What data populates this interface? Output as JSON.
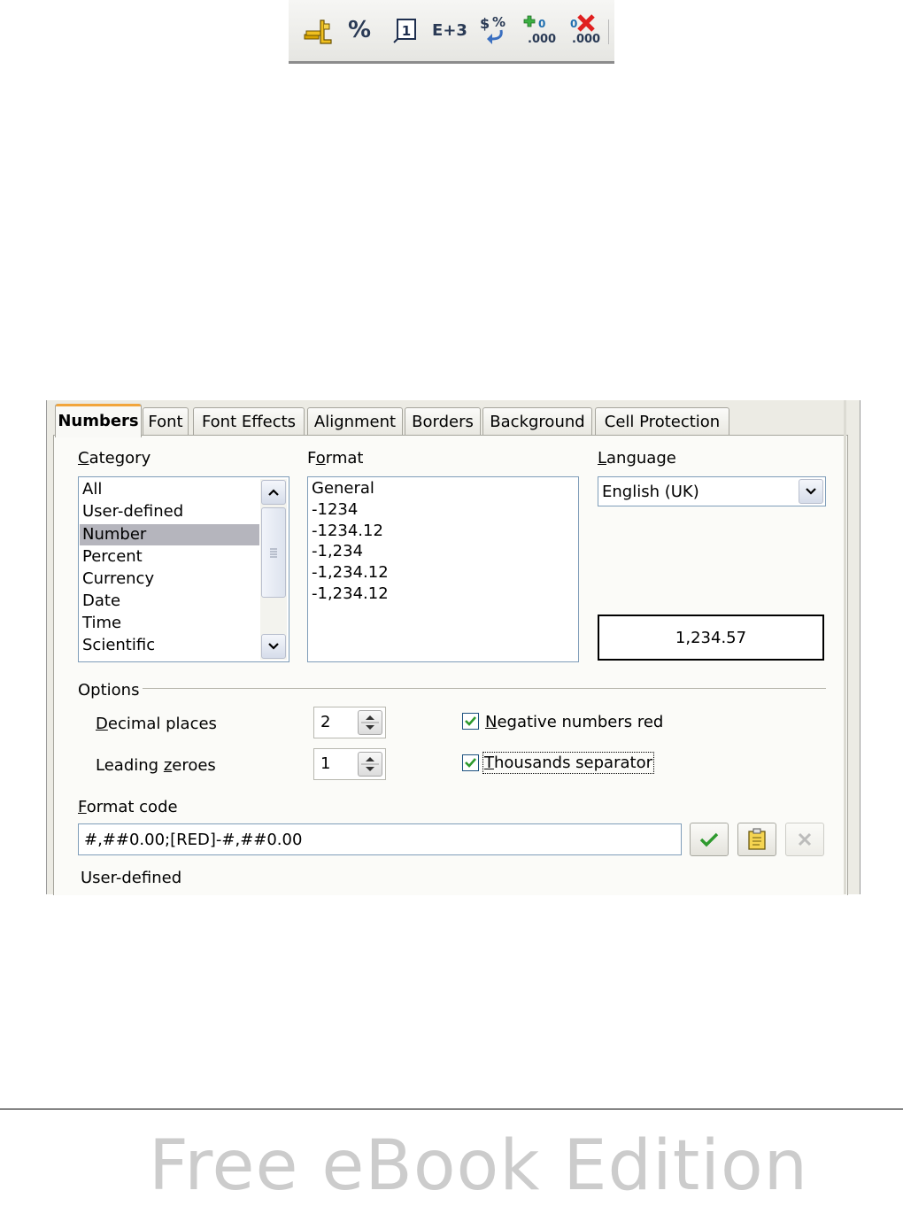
{
  "toolbar": {
    "buttons": [
      {
        "icon": "currency-format-icon"
      },
      {
        "icon": "percent-format-icon",
        "glyph": "%"
      },
      {
        "icon": "date-format-icon",
        "glyph": "1"
      },
      {
        "icon": "scientific-format-icon",
        "glyph": "E+3"
      },
      {
        "icon": "standard-format-icon",
        "glyph": "$%"
      },
      {
        "icon": "add-decimal-place-icon",
        "glyph": ".000"
      },
      {
        "icon": "delete-decimal-place-icon",
        "glyph": ".000"
      }
    ]
  },
  "dialog": {
    "tabs": [
      {
        "label": "Numbers",
        "active": true
      },
      {
        "label": "Font"
      },
      {
        "label": "Font Effects"
      },
      {
        "label": "Alignment"
      },
      {
        "label": "Borders"
      },
      {
        "label": "Background"
      },
      {
        "label": "Cell Protection"
      }
    ],
    "category": {
      "label": "Category",
      "items": [
        "All",
        "User-defined",
        "Number",
        "Percent",
        "Currency",
        "Date",
        "Time",
        "Scientific"
      ],
      "selected": "Number"
    },
    "format": {
      "label": "Format",
      "items": [
        "General",
        "-1234",
        "-1234.12",
        "-1,234",
        "-1,234.12",
        "-1,234.12"
      ]
    },
    "language": {
      "label": "Language",
      "value": "English (UK)"
    },
    "preview": "1,234.57",
    "options": {
      "label": "Options",
      "decimal_places": {
        "label": "Decimal places",
        "value": "2"
      },
      "leading_zeroes": {
        "label": "Leading zeroes",
        "value": "1"
      },
      "negative_red": {
        "label": "Negative numbers red",
        "checked": true
      },
      "thousands_separator": {
        "label": "Thousands separator",
        "checked": true
      }
    },
    "format_code": {
      "label": "Format code",
      "value": "#,##0.00;[RED]-#,##0.00",
      "description": "User-defined"
    },
    "colors": {
      "accent_tab": "#f2a53b",
      "check_green": "#2e9a2e",
      "delete_red": "#e02020"
    }
  },
  "footer": {
    "text": "Free eBook Edition"
  }
}
